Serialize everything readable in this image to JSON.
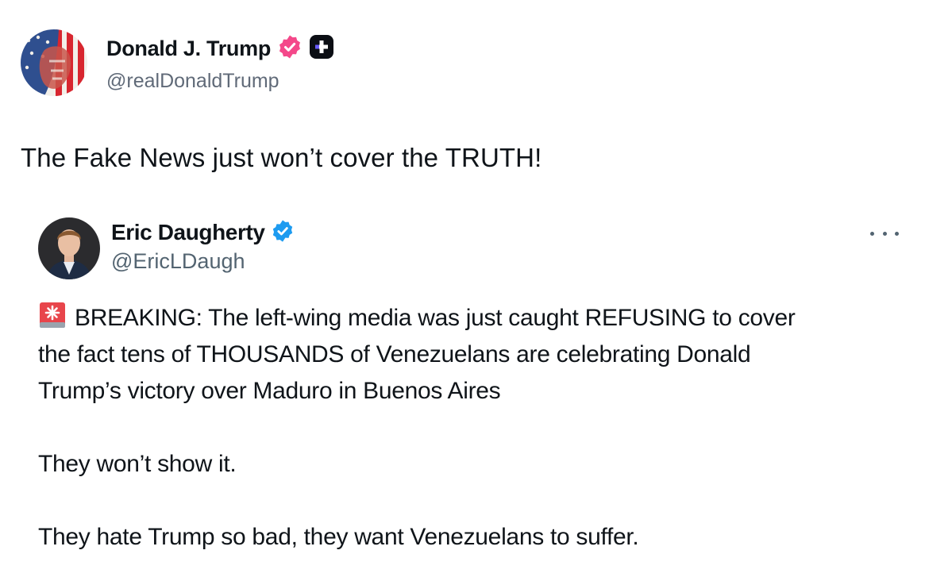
{
  "outer_post": {
    "author_name": "Donald J. Trump",
    "author_handle": "@realDonaldTrump",
    "avatar_icon": "flag-portrait-avatar",
    "verified_icon": "verified-badge-icon",
    "verified_color": "#f4488a",
    "plus_badge_icon": "truth-plus-badge-icon",
    "text": "The Fake News just won’t cover the TRUTH!"
  },
  "quoted_tweet": {
    "author_name": "Eric Daugherty",
    "author_handle": "@EricLDaugh",
    "verified_icon": "verified-badge-icon",
    "verified_color": "#1d9bf0",
    "more_icon": "more-options-icon",
    "lead_icon": "rotating-light-icon",
    "paragraph1": {
      "line1": "BREAKING: The left-wing media was just caught REFUSING to cover",
      "line2": "the fact tens of THOUSANDS of Venezuelans are celebrating Donald",
      "line3": "Trump’s victory over Maduro in Buenos Aires"
    },
    "paragraph2": "They won’t show it.",
    "paragraph3": "They hate Trump so bad, they want Venezuelans to suffer."
  }
}
